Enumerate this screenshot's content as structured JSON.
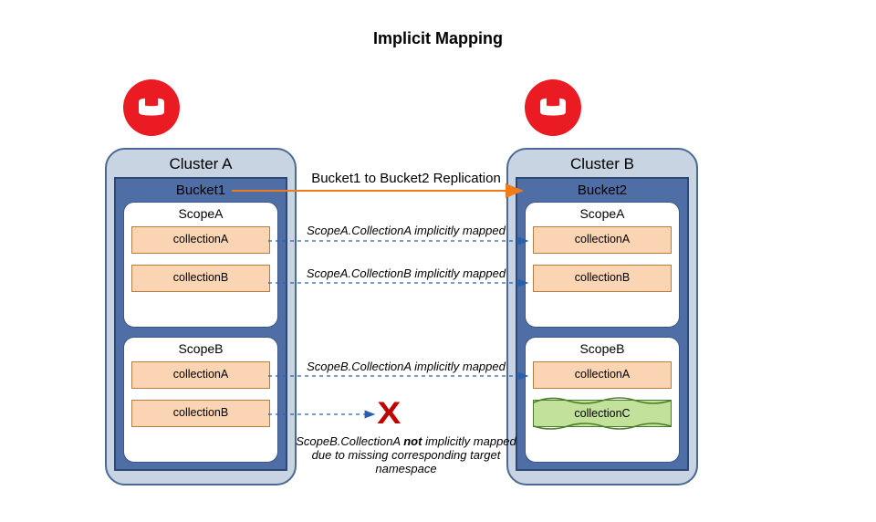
{
  "title": "Implicit Mapping",
  "clusterA": {
    "name": "Cluster A",
    "bucket": "Bucket1",
    "scopes": [
      {
        "name": "ScopeA",
        "collections": [
          "collectionA",
          "collectionB"
        ]
      },
      {
        "name": "ScopeB",
        "collections": [
          "collectionA",
          "collectionB"
        ]
      }
    ]
  },
  "clusterB": {
    "name": "Cluster B",
    "bucket": "Bucket2",
    "scopes": [
      {
        "name": "ScopeA",
        "collections": [
          "collectionA",
          "collectionB"
        ]
      },
      {
        "name": "ScopeB",
        "collections": [
          "collectionA",
          "collectionC"
        ]
      }
    ]
  },
  "labels": {
    "replication": "Bucket1 to Bucket2 Replication",
    "map1": "ScopeA.CollectionA implicitly mapped",
    "map2": "ScopeA.CollectionB implicitly mapped",
    "map3": "ScopeB.CollectionA implicitly mapped",
    "x": "X",
    "foot1": "ScopeB.CollectionA ",
    "foot_bold": "not",
    "foot2": " implicitly mapped",
    "foot3": "due to missing corresponding target",
    "foot4": "namespace"
  },
  "colors": {
    "logo": "#ea1b22",
    "cluster_bg": "#c9d4e3",
    "bucket_bg": "#4e6ea5",
    "collection_bg": "#fad4b3",
    "collectionC_bg": "#c2e19a",
    "dash": "#2a5fb0",
    "rep_arrow": "#ef7c1a"
  }
}
